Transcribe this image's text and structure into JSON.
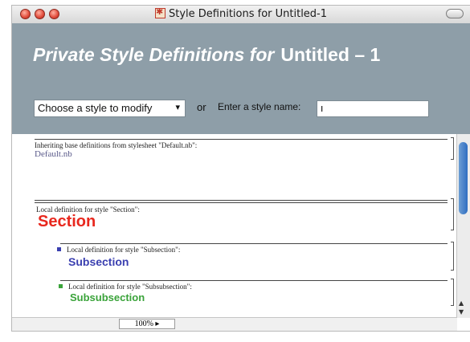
{
  "window": {
    "title": "Style Definitions for Untitled-1"
  },
  "header": {
    "title_prefix": "Private Style Definitions for",
    "title_name": "Untitled – 1",
    "style_select": "Choose a style to modify",
    "or_label": "or",
    "enter_label": "Enter a style name:",
    "style_name_value": "ı"
  },
  "cells": {
    "inherit_label": "Inheriting base definitions from stylesheet \"Default.nb\":",
    "inherit_value": "Default.nb",
    "section_label": "Local definition for style \"Section\":",
    "section_value": "Section",
    "subsection_label": "Local definition for style \"Subsection\":",
    "subsection_value": "Subsection",
    "subsubsection_label": "Local definition for style \"Subsubsection\":",
    "subsubsection_value": "Subsubsection"
  },
  "zoom": "100%",
  "zoom_arrow": "▸",
  "colors": {
    "header_bg": "#8e9ea8",
    "section": "#e8281e",
    "subsection": "#3a3fb0",
    "subsubsection": "#3aa33a"
  },
  "icons": {
    "close": "close-button-icon",
    "minimize": "minimize-button-icon",
    "zoom": "zoom-button-icon",
    "document": "document-icon",
    "toolbar": "toolbar-toggle-icon",
    "dropdown": "dropdown-arrow-icon",
    "scroll_up": "scroll-up-arrow-icon",
    "scroll_down": "scroll-down-arrow-icon"
  }
}
